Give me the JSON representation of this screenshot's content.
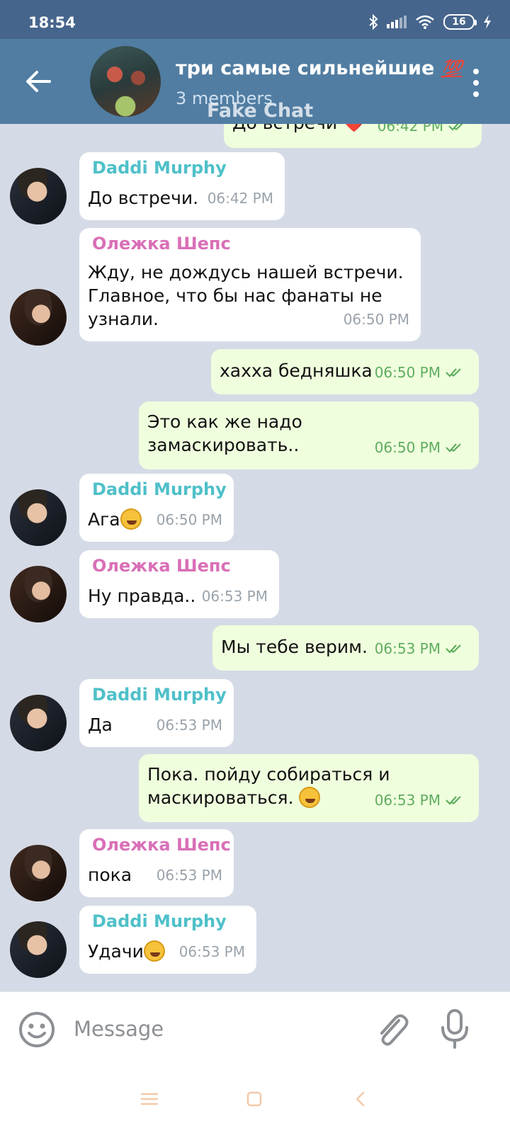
{
  "status": {
    "time": "18:54",
    "battery": "16"
  },
  "header": {
    "title": "три самые сильнейшие",
    "title_emoji": "💯",
    "subtitle": "3 members",
    "watermark": "Fake Chat"
  },
  "messages": [
    {
      "side": "out",
      "text": "До встречи ❤️",
      "time": "06:42 PM"
    },
    {
      "side": "in",
      "sender": "Daddi Murphy",
      "text": "До встречи.",
      "time": "06:42 PM"
    },
    {
      "side": "in",
      "sender": "Олежка Шепс",
      "lines": [
        "Жду, не дождусь нашей встречи.",
        "Главное, что бы нас фанаты не",
        "узнали."
      ],
      "time": "06:50 PM"
    },
    {
      "side": "out",
      "text": "хахха бедняшка",
      "time": "06:50 PM"
    },
    {
      "side": "out",
      "lines": [
        "Это как же надо",
        "замаскировать.."
      ],
      "time": "06:50 PM"
    },
    {
      "side": "in",
      "sender": "Daddi Murphy",
      "text": "Ага",
      "emoji": "😂",
      "time": "06:50 PM"
    },
    {
      "side": "in",
      "sender": "Олежка Шепс",
      "text": "Ну правда..",
      "time": "06:53 PM"
    },
    {
      "side": "out",
      "text": "Мы тебе верим.",
      "time": "06:53 PM"
    },
    {
      "side": "in",
      "sender": "Daddi Murphy",
      "text": "Да",
      "time": "06:53 PM"
    },
    {
      "side": "out",
      "lines": [
        "Пока. пойду собираться и",
        "маскироваться."
      ],
      "emoji": "🤣",
      "time": "06:53 PM"
    },
    {
      "side": "in",
      "sender": "Олежка Шепс",
      "text": "пока",
      "time": "06:53 PM"
    },
    {
      "side": "in",
      "sender": "Daddi Murphy",
      "text": "Удачи",
      "emoji": "🤣",
      "time": "06:53 PM"
    }
  ],
  "input": {
    "placeholder": "Message"
  },
  "icons": [
    "back-arrow-icon",
    "more-vert-icon",
    "emoji-icon",
    "attach-icon",
    "mic-icon",
    "double-check-icon"
  ],
  "colors": {
    "header": "#517da2",
    "status_bar": "#46658c",
    "chat_bg": "#d5dbe6",
    "out_bubble": "#effedd",
    "in_bubble": "#ffffff",
    "daddi_name": "#4fc0c9",
    "oleg_name": "#d96fb7",
    "check": "#5fad60"
  }
}
